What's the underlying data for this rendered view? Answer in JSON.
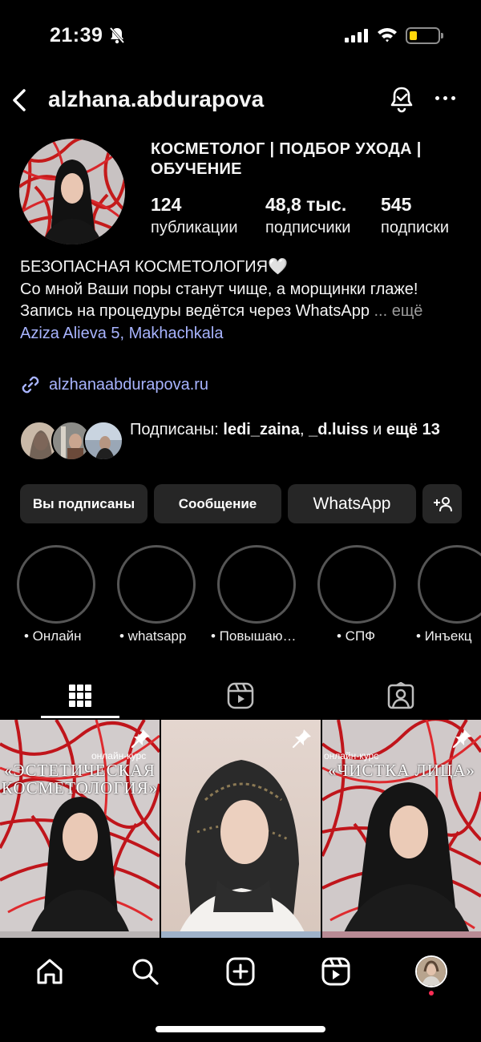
{
  "status_bar": {
    "time": "21:39"
  },
  "header": {
    "username": "alzhana.abdurapova"
  },
  "profile": {
    "title": "КОСМЕТОЛОГ | ПОДБОР УХОДА | ОБУЧЕНИЕ",
    "stats": [
      {
        "value": "124",
        "label": "публикации"
      },
      {
        "value": "48,8 тыс.",
        "label": "подписчики"
      },
      {
        "value": "545",
        "label": "подписки"
      }
    ]
  },
  "bio": {
    "line1": "БЕЗОПАСНАЯ КОСМЕТОЛОГИЯ🤍",
    "line2": "Со мной Ваши поры станут чище, а морщинки глаже!",
    "line3": "Запись на процедуры ведётся через WhatsApp",
    "more": "... ещё",
    "location": "Aziza Alieva 5, Makhachkala",
    "link": "alzhanaabdurapova.ru"
  },
  "followed_by": {
    "prefix": "Подписаны: ",
    "user1": "ledi_zaina",
    "sep": ", ",
    "user2": "_d.luiss",
    "and": " и ",
    "rest": "ещё 13"
  },
  "buttons": {
    "following": "Вы подписаны",
    "message": "Сообщение",
    "whatsapp": "WhatsApp"
  },
  "highlights": [
    {
      "label": "• Онлайн"
    },
    {
      "label": "• whatsapp"
    },
    {
      "label": "• Повышаю…"
    },
    {
      "label": "• СПФ"
    },
    {
      "label": "• Инъекц"
    }
  ],
  "posts": [
    {
      "subtitle": "онлайн-курс",
      "title_line1": "«ЭСТЕТИЧЕСКАЯ",
      "title_line2": "КОСМЕТОЛОГИЯ»"
    },
    {},
    {
      "subtitle": "онлайн-курс",
      "title_line1": "«ЧИСТКА ЛИЦА»"
    }
  ],
  "colors": {
    "accent_link": "#a8b4ff",
    "button_bg": "#262626",
    "battery": "#ffd60a",
    "notification_dot": "#ff2d55"
  }
}
